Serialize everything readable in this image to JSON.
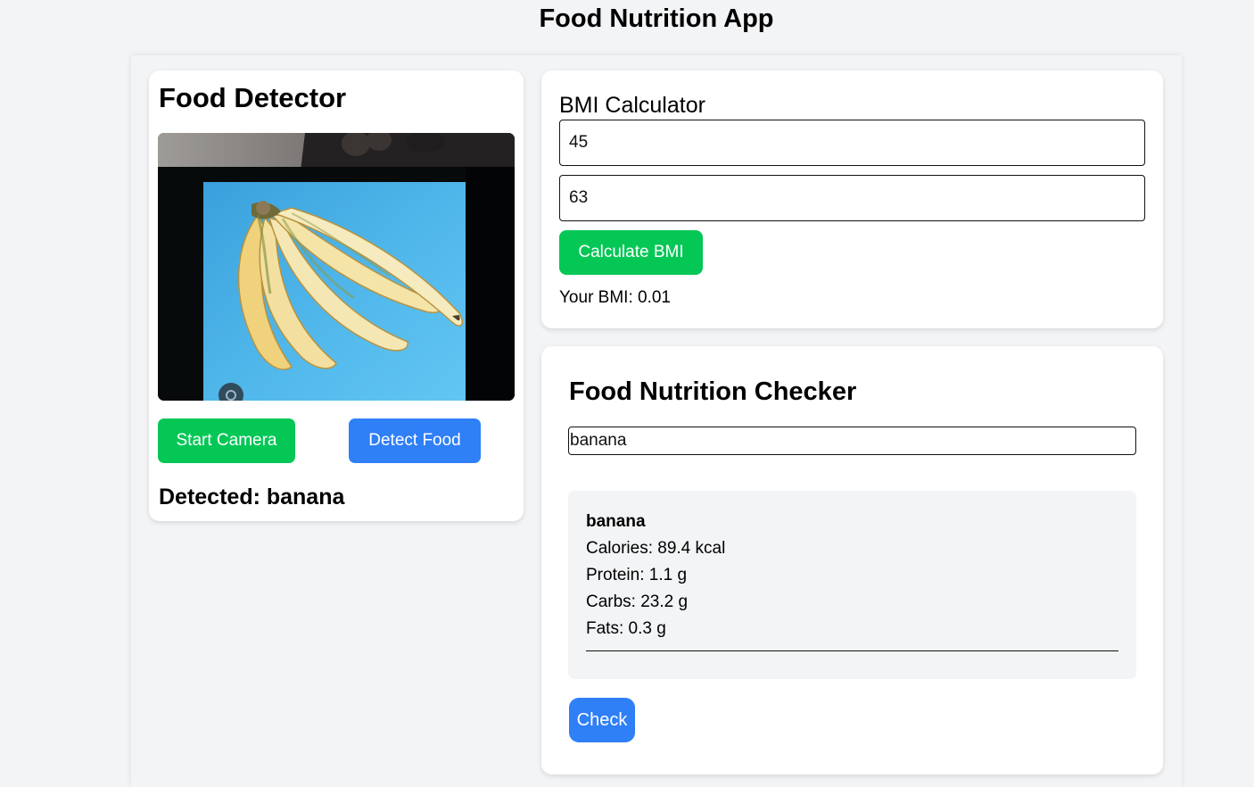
{
  "app": {
    "title": "Food Nutrition App"
  },
  "detector": {
    "title": "Food Detector",
    "start_label": "Start Camera",
    "detect_label": "Detect Food",
    "detected_text": "Detected: banana"
  },
  "bmi": {
    "title": "BMI Calculator",
    "weight_value": "45",
    "height_value": "63",
    "calculate_label": "Calculate BMI",
    "result_text": "Your BMI: 0.01"
  },
  "nutrition": {
    "title": "Food Nutrition Checker",
    "query_value": "banana",
    "result": {
      "name": "banana",
      "calories": "Calories: 89.4 kcal",
      "protein": "Protein: 1.1 g",
      "carbs": "Carbs: 23.2 g",
      "fats": "Fats: 0.3 g"
    },
    "check_label": "Check"
  },
  "colors": {
    "page_bg": "#f3f4f6",
    "card_bg": "#ffffff",
    "green_button": "#05c756",
    "blue_button": "#2f7ff7",
    "result_box_bg": "#f3f4f6"
  },
  "icons": {
    "camera_overlay": "camera-switch-icon"
  }
}
